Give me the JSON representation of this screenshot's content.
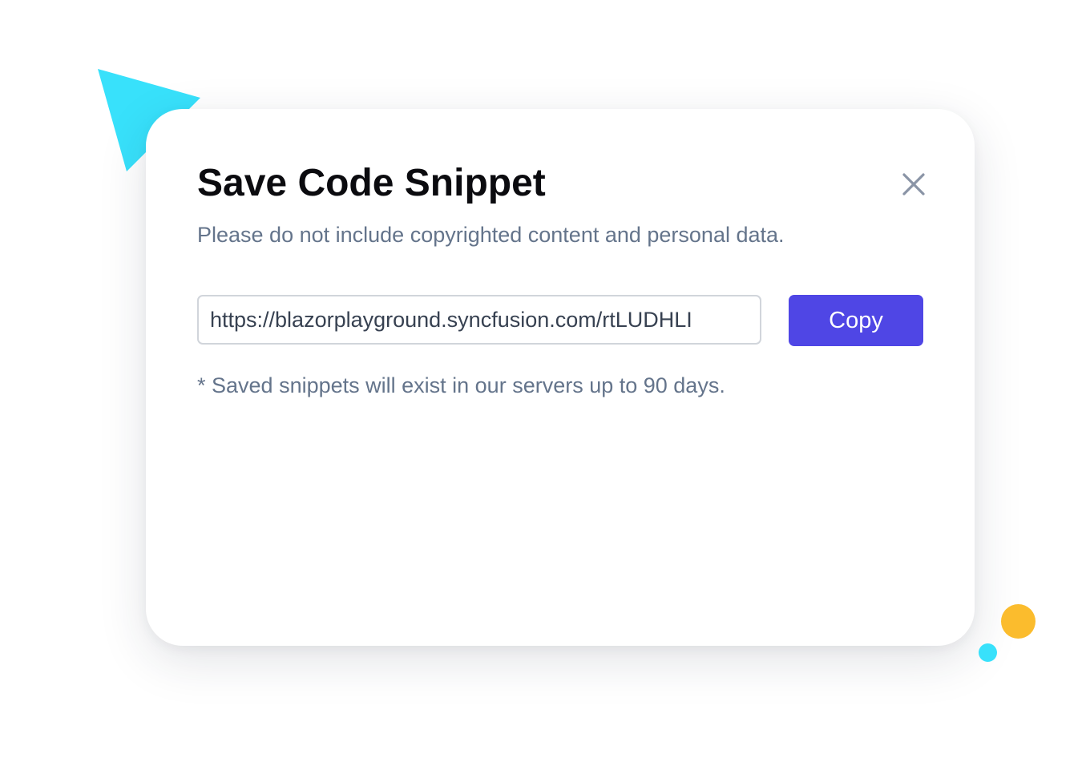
{
  "dialog": {
    "title": "Save Code Snippet",
    "subtitle": "Please do not include copyrighted content and personal data.",
    "url_value": "https://blazorplayground.syncfusion.com/rtLUDHLI",
    "copy_label": "Copy",
    "note": "* Saved snippets will exist in our servers up to 90 days.",
    "close_icon": "close-icon"
  },
  "colors": {
    "accent": "#4f46e5",
    "decor_cyan": "#38e1fb",
    "decor_yellow": "#fbbc2d",
    "muted_text": "#64748b",
    "title_text": "#0b0b0f"
  }
}
